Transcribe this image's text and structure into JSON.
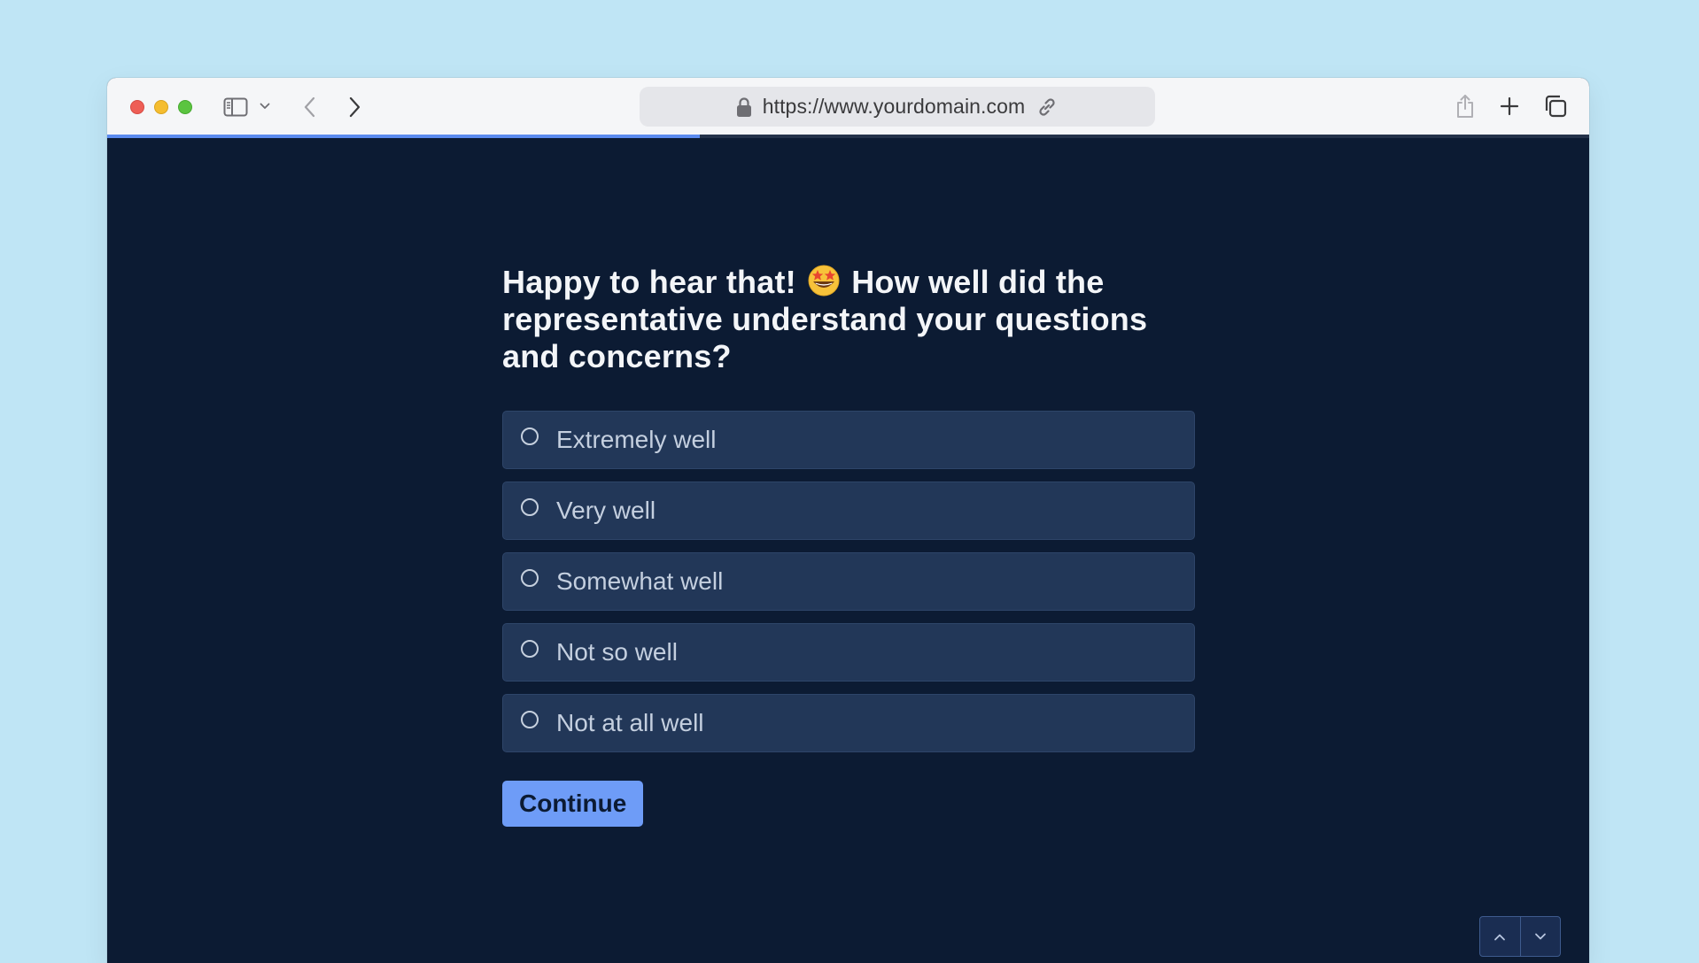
{
  "browser": {
    "url": "https://www.yourdomain.com",
    "icons": [
      "sidebar-icon",
      "chevron-down-icon",
      "back-icon",
      "forward-icon",
      "lock-icon",
      "link-icon",
      "share-icon",
      "new-tab-icon",
      "tabs-overview-icon"
    ]
  },
  "form": {
    "progress_fraction": 0.4,
    "question_before_emoji": "Happy to hear that!",
    "emoji": "star-struck-emoji",
    "question_after_emoji": "How well did the representative understand your questions and concerns?",
    "options": [
      {
        "label": "Extremely well"
      },
      {
        "label": "Very well"
      },
      {
        "label": "Somewhat well"
      },
      {
        "label": "Not so well"
      },
      {
        "label": "Not at all well"
      }
    ],
    "continue_label": "Continue",
    "nav": {
      "up_icon": "chevron-up-icon",
      "down_icon": "chevron-down-icon"
    }
  },
  "colors": {
    "page_background": "#bfe5f5",
    "form_background": "#0c1b33",
    "option_background": "#223758",
    "accent": "#6e9cf7",
    "progress": "#5b8bef"
  }
}
